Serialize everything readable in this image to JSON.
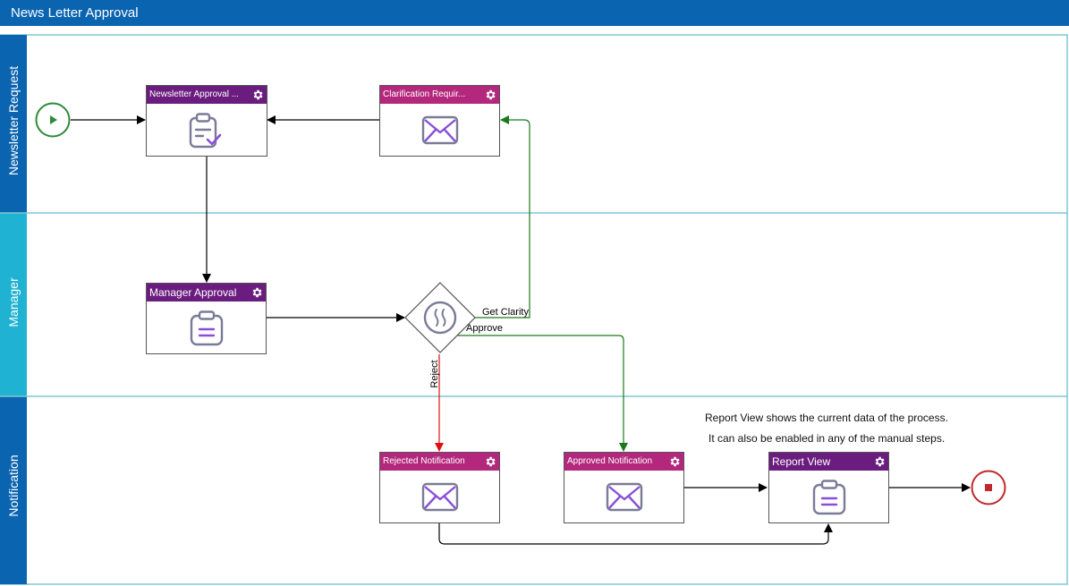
{
  "window": {
    "title": "News Letter Approval"
  },
  "lanes": [
    {
      "id": "lane-newsletter-request",
      "label": "Newsletter Request",
      "color": "#0b64b0"
    },
    {
      "id": "lane-manager",
      "label": "Manager",
      "color": "#1fb2d3"
    },
    {
      "id": "lane-notification",
      "label": "Notification",
      "color": "#0b64b0"
    }
  ],
  "nodes": {
    "newsletter_approval": {
      "label": "Newsletter Approval ...",
      "kind": "form-task",
      "header_color": "#6b1d7f"
    },
    "clarification": {
      "label": "Clarification Requir...",
      "kind": "email-task",
      "header_color": "#b3287c"
    },
    "manager_approval": {
      "label": "Manager Approval",
      "kind": "form-task",
      "header_color": "#6b1d7f"
    },
    "rejected_notification": {
      "label": "Rejected Notification",
      "kind": "email-task",
      "header_color": "#b3287c"
    },
    "approved_notification": {
      "label": "Approved Notification",
      "kind": "email-task",
      "header_color": "#b3287c"
    },
    "report_view": {
      "label": "Report View",
      "kind": "report-task",
      "header_color": "#6b1d7f"
    }
  },
  "edges": {
    "get_clarity": "Get Clarity",
    "approve": "Approve",
    "reject": "Reject"
  },
  "note": {
    "line1": "Report View shows the current data of the process.",
    "line2": "It can also be enabled in any of the manual steps."
  },
  "icons": {
    "start": "play-icon",
    "end": "stop-icon",
    "gateway": "waves-icon",
    "gear": "gear-icon",
    "email": "envelope-icon",
    "form": "clipboard-icon"
  },
  "colors": {
    "flow_default": "#000000",
    "flow_approve": "#1a7a1a",
    "flow_reject": "#e01010",
    "start_event": "#2e8b3a",
    "end_event": "#c0282c",
    "icon_stroke": "#7a7b96",
    "icon_accent": "#8a4fd6"
  }
}
